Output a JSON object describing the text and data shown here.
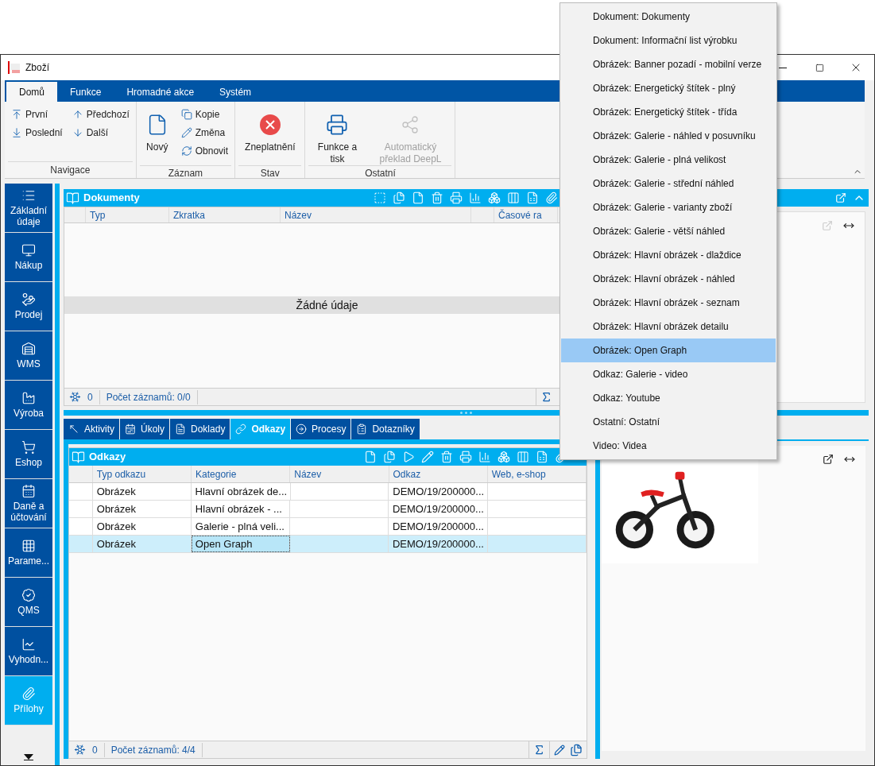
{
  "window": {
    "title": "Zboží"
  },
  "ribbon": {
    "tabs": [
      {
        "label": "Domů",
        "selected": true
      },
      {
        "label": "Funkce",
        "selected": false
      },
      {
        "label": "Hromadné akce",
        "selected": false
      },
      {
        "label": "Systém",
        "selected": false
      }
    ],
    "groups": [
      {
        "label": "Navigace",
        "items": [
          {
            "label": "První",
            "kind": "small",
            "disabled": false
          },
          {
            "label": "Poslední",
            "kind": "small",
            "disabled": false
          },
          {
            "label": "Předchozí",
            "kind": "small",
            "disabled": false
          },
          {
            "label": "Další",
            "kind": "small",
            "disabled": false
          }
        ]
      },
      {
        "label": "Záznam",
        "items": [
          {
            "label": "Nový",
            "kind": "large",
            "disabled": false
          },
          {
            "label": "Kopie",
            "kind": "small",
            "disabled": false
          },
          {
            "label": "Změna",
            "kind": "small",
            "disabled": false
          },
          {
            "label": "Obnovit",
            "kind": "small",
            "disabled": false
          }
        ]
      },
      {
        "label": "Stav",
        "items": [
          {
            "label": "Zneplatnění",
            "kind": "large",
            "disabled": false
          }
        ]
      },
      {
        "label": "Ostatní",
        "items": [
          {
            "label": "Funkce a tisk",
            "kind": "large",
            "disabled": false
          },
          {
            "label": "Automatický překlad DeepL",
            "kind": "large",
            "disabled": true
          }
        ]
      }
    ]
  },
  "sidebar": {
    "items": [
      {
        "label": "Základní údaje",
        "selected": false
      },
      {
        "label": "Nákup",
        "selected": false
      },
      {
        "label": "Prodej",
        "selected": false
      },
      {
        "label": "WMS",
        "selected": false
      },
      {
        "label": "Výroba",
        "selected": false
      },
      {
        "label": "Eshop",
        "selected": false
      },
      {
        "label": "Daně a účtování",
        "selected": false
      },
      {
        "label": "Parame...",
        "selected": false
      },
      {
        "label": "QMS",
        "selected": false
      },
      {
        "label": "Vyhodn...",
        "selected": false
      },
      {
        "label": "Přílohy",
        "selected": true
      }
    ]
  },
  "documents": {
    "title": "Dokumenty",
    "columns": [
      "Typ",
      "Zkratka",
      "Název",
      "Časové ra"
    ],
    "empty_message": "Žádné údaje",
    "footer": {
      "count": "0",
      "records": "Počet záznamů: 0/0"
    }
  },
  "detail_tabs": [
    {
      "label": "Aktivity",
      "selected": false
    },
    {
      "label": "Úkoly",
      "selected": false
    },
    {
      "label": "Doklady",
      "selected": false
    },
    {
      "label": "Odkazy",
      "selected": true
    },
    {
      "label": "Procesy",
      "selected": false
    },
    {
      "label": "Dotazníky",
      "selected": false
    }
  ],
  "links": {
    "title": "Odkazy",
    "columns": [
      "Typ odkazu",
      "Kategorie",
      "Název",
      "Odkaz",
      "Web, e-shop"
    ],
    "rows": [
      {
        "cells": [
          "Obrázek",
          "Hlavní obrázek de...",
          "",
          "DEMO/19/200000...",
          ""
        ],
        "selected": false
      },
      {
        "cells": [
          "Obrázek",
          "Hlavní obrázek - ...",
          "",
          "DEMO/19/200000...",
          ""
        ],
        "selected": false
      },
      {
        "cells": [
          "Obrázek",
          "Galerie - plná veli...",
          "",
          "DEMO/19/200000...",
          ""
        ],
        "selected": false
      },
      {
        "cells": [
          "Obrázek",
          "Open Graph",
          "",
          "DEMO/19/200000...",
          ""
        ],
        "selected": true
      }
    ],
    "footer": {
      "count": "0",
      "records": "Počet záznamů: 4/4"
    }
  },
  "menu": {
    "items": [
      {
        "label": "Dokument: Dokumenty",
        "selected": false
      },
      {
        "label": "Dokument: Informační list výrobku",
        "selected": false
      },
      {
        "label": "Obrázek: Banner pozadí - mobilní verze",
        "selected": false
      },
      {
        "label": "Obrázek: Energetický štítek - plný",
        "selected": false
      },
      {
        "label": "Obrázek: Energetický štítek - třída",
        "selected": false
      },
      {
        "label": "Obrázek: Galerie - náhled v posuvníku",
        "selected": false
      },
      {
        "label": "Obrázek: Galerie - plná velikost",
        "selected": false
      },
      {
        "label": "Obrázek: Galerie - střední náhled",
        "selected": false
      },
      {
        "label": "Obrázek: Galerie - varianty zboží",
        "selected": false
      },
      {
        "label": "Obrázek: Galerie - větší náhled",
        "selected": false
      },
      {
        "label": "Obrázek: Hlavní obrázek - dlaždice",
        "selected": false
      },
      {
        "label": "Obrázek: Hlavní obrázek - náhled",
        "selected": false
      },
      {
        "label": "Obrázek: Hlavní obrázek - seznam",
        "selected": false
      },
      {
        "label": "Obrázek: Hlavní obrázek detailu",
        "selected": false
      },
      {
        "label": "Obrázek: Open Graph",
        "selected": true
      },
      {
        "label": "Odkaz: Galerie - video",
        "selected": false
      },
      {
        "label": "Odkaz: Youtube",
        "selected": false
      },
      {
        "label": "Ostatní: Ostatní",
        "selected": false
      },
      {
        "label": "Video: Videa",
        "selected": false
      }
    ]
  }
}
